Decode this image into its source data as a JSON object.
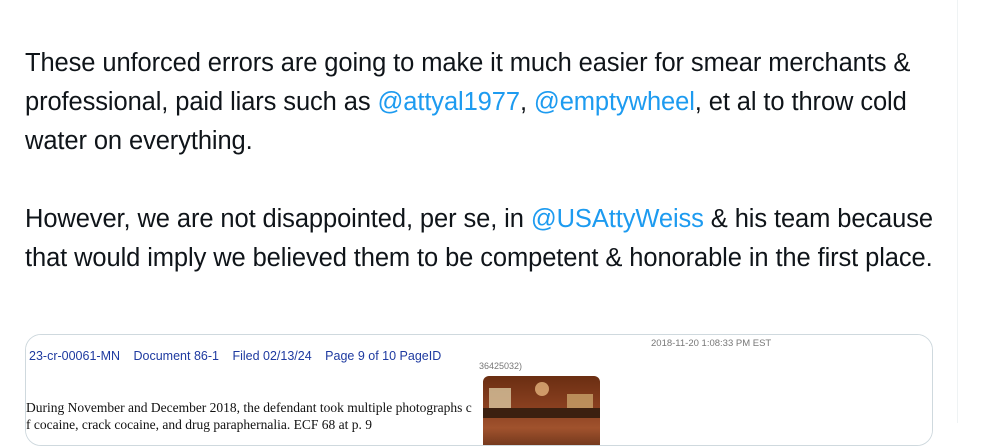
{
  "tweet": {
    "paragraph1": {
      "text_before": "These unforced errors are going to make it much easier for smear merchants & professional, paid liars such as ",
      "mention1": "@attyal1977",
      "separator": ", ",
      "mention2": "@emptywheel",
      "text_after": ", et al to throw cold water on everything."
    },
    "paragraph2": {
      "text_before": "However, we are not disappointed, per se, in ",
      "mention": "@USAttyWeiss",
      "text_after": " & his team because that would imply we believed them to be competent & honorable in the first place."
    }
  },
  "media": {
    "document": {
      "case_number": "23-cr-00061-MN",
      "document": "Document 86-1",
      "filed": "Filed 02/13/24",
      "page": "Page 9 of 10 PageID",
      "line1": "During November and December 2018, the defendant took multiple photographs c",
      "line2": "f cocaine, crack cocaine, and drug paraphernalia.  ECF 68 at p. 9"
    },
    "photo": {
      "timestamp": "2018-11-20 1:08:33 PM EST",
      "id_fragment": "36425032)"
    }
  },
  "colors": {
    "mention": "#1d9bf0",
    "text": "#0f1419",
    "border": "#cfd9de"
  }
}
